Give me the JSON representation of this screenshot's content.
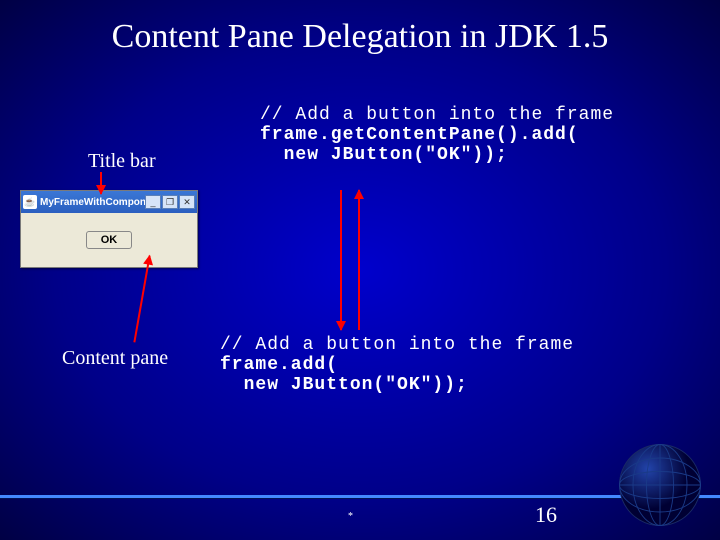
{
  "title": "Content Pane Delegation in JDK 1.5",
  "labels": {
    "titleBar": "Title bar",
    "contentPane": "Content pane"
  },
  "frame": {
    "windowTitle": "MyFrameWithComponents",
    "iconGlyph": "☕",
    "minBtn": "_",
    "maxBtn": "❐",
    "closeBtn": "✕",
    "okButton": "OK"
  },
  "code": {
    "block1Comment": "// Add a button into the frame",
    "block1Line1": "frame.getContentPane().add(",
    "block1Line2": "  new JButton(\"OK\"));",
    "block2Comment": "// Add a button into the frame",
    "block2Line1": "frame.add(",
    "block2Line2": "  new JButton(\"OK\"));"
  },
  "footer": {
    "dot": "*",
    "pageNumber": "16"
  }
}
